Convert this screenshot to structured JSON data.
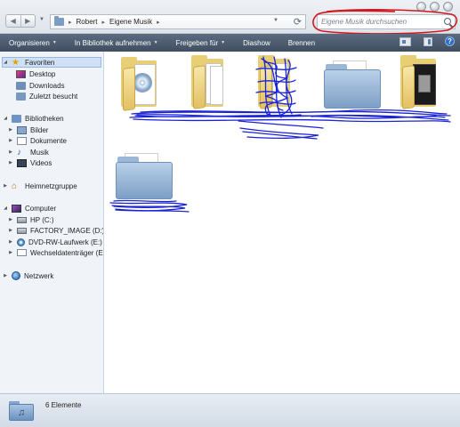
{
  "window": {
    "breadcrumb": [
      "Robert",
      "Eigene Musik"
    ],
    "search_placeholder": "Eigene Musik durchsuchen"
  },
  "toolbar": {
    "commands": [
      "Organisieren",
      "In Bibliothek aufnehmen",
      "Freigeben für",
      "Diashow",
      "Brennen"
    ],
    "help_label": "?"
  },
  "sidebar": {
    "favorites": {
      "label": "Favoriten",
      "items": [
        "Desktop",
        "Downloads",
        "Zuletzt besucht"
      ]
    },
    "libraries": {
      "label": "Bibliotheken",
      "items": [
        "Bilder",
        "Dokumente",
        "Musik",
        "Videos"
      ]
    },
    "homegroup": {
      "label": "Heimnetzgruppe"
    },
    "computer": {
      "label": "Computer",
      "items": [
        "HP (C:)",
        "FACTORY_IMAGE (D:)",
        "DVD-RW-Laufwerk (E:) A",
        "Wechseldatenträger (E:)"
      ]
    },
    "network": {
      "label": "Netzwerk"
    }
  },
  "content": {
    "folder_count": 6,
    "folder_types": [
      "music-cd",
      "documents",
      "documents-scribbled",
      "plain-blue",
      "dark-media",
      "plain-blue"
    ]
  },
  "status": {
    "item_count": "6 Elemente"
  },
  "colors": {
    "command_bar": "#4a596c",
    "sidebar": "#f0f4f9",
    "selection": "#cfe0f4",
    "scribble": "#1a23d6",
    "highlight_circle": "#d0191f"
  }
}
